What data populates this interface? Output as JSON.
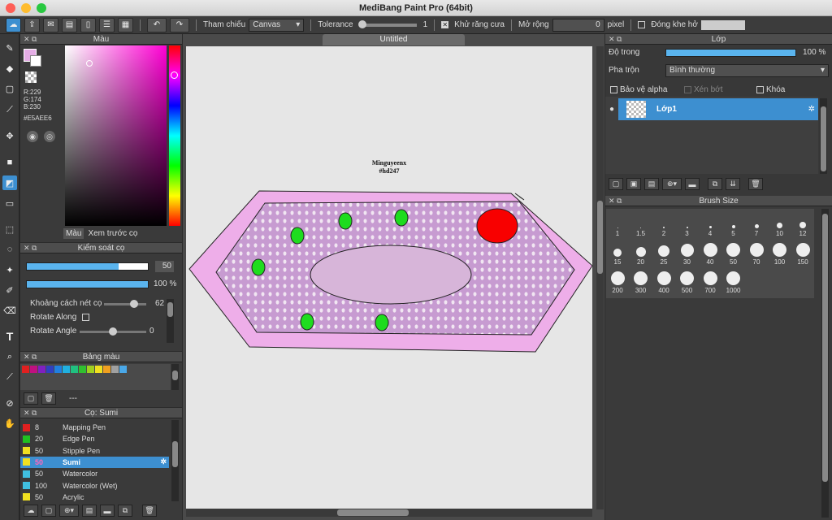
{
  "window": {
    "title": "MediBang Paint Pro (64bit)"
  },
  "toolbar": {
    "reference_label": "Tham chiếu",
    "reference_value": "Canvas",
    "tolerance_label": "Tolerance",
    "tolerance_value": "1",
    "antialias_label": "Khử răng cưa",
    "expand_label": "Mở rộng",
    "expand_value": "0",
    "expand_unit": "pixel",
    "close_gap_label": "Đóng khe hở"
  },
  "color_panel": {
    "title": "Màu",
    "r": "R:229",
    "g": "G:174",
    "b": "B:230",
    "hex": "#E5AEE6",
    "tab_color": "Màu",
    "tab_preview": "Xem trước cọ",
    "primary_color": "#E5AEE6"
  },
  "brush_control": {
    "title": "Kiểm soát cọ",
    "size_value": "50",
    "size_fill": 0.76,
    "opacity_value": "100 %",
    "opacity_fill": 1.0,
    "spacing_label": "Khoảng cách nét cọ",
    "spacing_value": "62",
    "rotate_along_label": "Rotate Along",
    "rotate_angle_label": "Rotate Angle",
    "rotate_angle_value": "0"
  },
  "palette": {
    "title": "Bảng màu",
    "dashes": "---",
    "swatches": [
      "#e02020",
      "#c01080",
      "#8020c0",
      "#3040c0",
      "#2080e0",
      "#20b0e0",
      "#20c080",
      "#30c030",
      "#a0d020",
      "#f0e020",
      "#f0a020",
      "#a0a0a0",
      "#4aa8e8"
    ]
  },
  "brush_list": {
    "title": "Cọ: Sumi",
    "items": [
      {
        "size": "8",
        "name": "Mapping Pen",
        "color": "#e02020"
      },
      {
        "size": "20",
        "name": "Edge Pen",
        "color": "#20c020"
      },
      {
        "size": "50",
        "name": "Stipple Pen",
        "color": "#f0e020"
      },
      {
        "size": "50",
        "name": "Sumi",
        "color": "#f0e020"
      },
      {
        "size": "50",
        "name": "Watercolor",
        "color": "#40c0e0"
      },
      {
        "size": "100",
        "name": "Watercolor (Wet)",
        "color": "#40c0e0"
      },
      {
        "size": "50",
        "name": "Acrylic",
        "color": "#f0e020"
      }
    ]
  },
  "document": {
    "tab": "Untitled",
    "text_line1": "Minguyeenx",
    "text_line2": "#hd247"
  },
  "layer_panel": {
    "title": "Lớp",
    "opacity_label": "Độ trong",
    "opacity_value": "100 %",
    "blend_label": "Pha trộn",
    "blend_value": "Bình thường",
    "protect_alpha": "Bảo vệ alpha",
    "clipping": "Xén bớt",
    "lock": "Khóa",
    "layer_name": "Lớp1"
  },
  "brush_size_panel": {
    "title": "Brush Size",
    "sizes": [
      "1",
      "1.5",
      "2",
      "3",
      "4",
      "5",
      "7",
      "10",
      "12",
      "15",
      "20",
      "25",
      "30",
      "40",
      "50",
      "70",
      "100",
      "150",
      "200",
      "300",
      "400",
      "500",
      "700",
      "1000"
    ]
  }
}
